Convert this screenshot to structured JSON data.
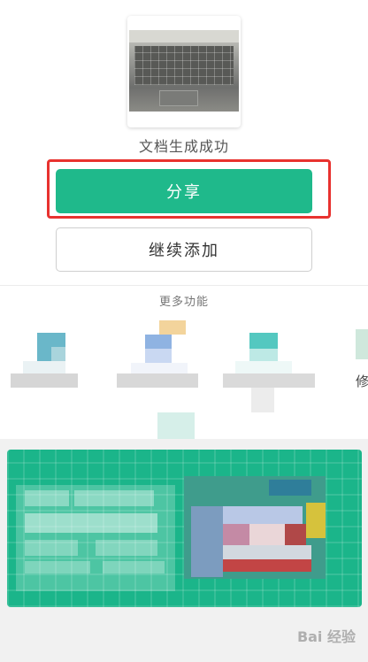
{
  "status": {
    "text": "文档生成成功"
  },
  "actions": {
    "share_label": "分享",
    "continue_label": "继续添加"
  },
  "more": {
    "title": "更多功能",
    "partial_label": "修"
  },
  "watermark": {
    "text": "Bai 经验"
  },
  "colors": {
    "accent": "#1fb98b",
    "highlight": "#e8322f"
  }
}
